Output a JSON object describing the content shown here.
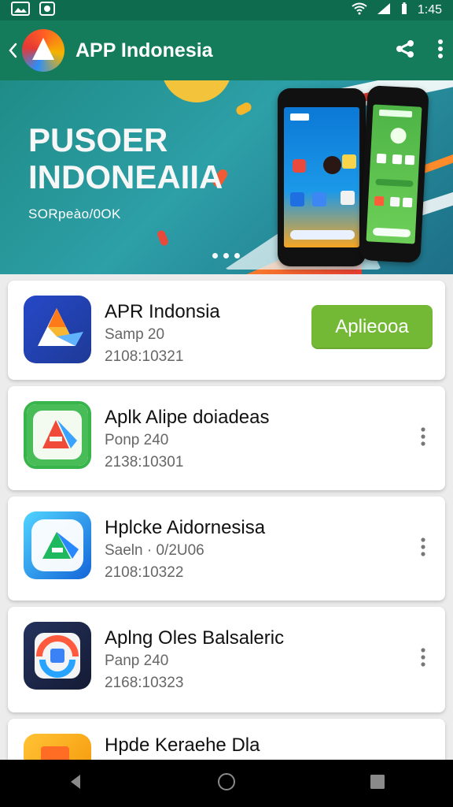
{
  "status_bar": {
    "time": "1:45"
  },
  "app_bar": {
    "title": "APP Indonesia"
  },
  "banner": {
    "title_line_1": "PUSOER",
    "title_line_2": "INDONEAIIA",
    "subtitle": "SORpeào/0OK"
  },
  "apps": [
    {
      "title": "APR Indonsia",
      "subtitle": "Samp 20",
      "code": "2108:10321",
      "action": "Aplieooa"
    },
    {
      "title": "Aplk Alipe doiadeas",
      "subtitle": "Ponp 240",
      "code": "2138:10301"
    },
    {
      "title": "Hplcke Aidornesisa",
      "subtitle": "Saeln · 0/2U06",
      "code": "2108:10322"
    },
    {
      "title": "Aplng Oles Balsaleric",
      "subtitle": "Panp 240",
      "code": "2168:10323"
    },
    {
      "title": "Hpde Keraehe Dla"
    }
  ],
  "colors": {
    "status_bar": "#0f6b4d",
    "app_bar": "#147c5a",
    "banner": "#1f8c87",
    "install_button": "#74b936",
    "card": "#ffffff",
    "page_bg": "#ececec"
  },
  "icons": {
    "back": "back-arrow-icon",
    "share": "share-icon",
    "menu": "more-vertical-icon",
    "wifi": "wifi-icon",
    "signal": "signal-icon",
    "battery": "battery-icon",
    "nav_back": "triangle-back-icon",
    "nav_home": "home-circle-icon",
    "nav_recent": "recent-square-icon"
  }
}
